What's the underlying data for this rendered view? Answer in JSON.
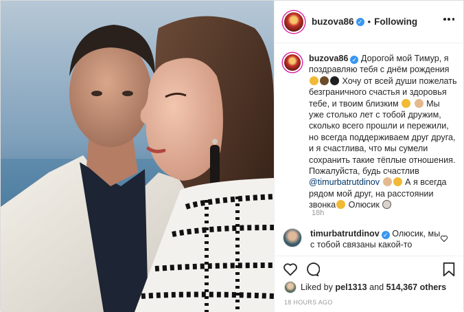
{
  "post": {
    "username": "buzova86",
    "follow_status": "Following",
    "caption_parts": {
      "p1": "Дорогой мой Тимур, я поздравляю тебя с днём рождения",
      "p2": "Хочу от всей души пожелать безграничного счастья и здоровья тебе, и твоим близким",
      "p3": "Мы уже столько лет с тобой дружим, сколько всего прошли и пережили, но всегда поддерживаем друг друга, и я счастлива, что мы сумели сохранить такие тёплые отношения. Пожалуйста, будь счастлив",
      "mention": "@timurbatrutdinov",
      "p4": "А я всегда рядом мой друг, на расстоянии звонка",
      "p5": "Олюсик"
    },
    "caption_time": "18h"
  },
  "comment": {
    "username": "timurbatrutdinov",
    "text": "Олюсик, мы с тобой связаны какой-то"
  },
  "likes": {
    "prefix": "Liked by",
    "user": "pel1313",
    "middle": "and",
    "count": "514,367 others"
  },
  "timestamp": "18 HOURS AGO",
  "icons": {
    "more": "more-options-icon",
    "heart": "heart-icon",
    "comment": "comment-icon",
    "bookmark": "bookmark-icon",
    "verified": "verified-badge-icon"
  },
  "colors": {
    "text": "#262626",
    "muted": "#999999",
    "verified": "#3897f0",
    "mention": "#003569"
  }
}
